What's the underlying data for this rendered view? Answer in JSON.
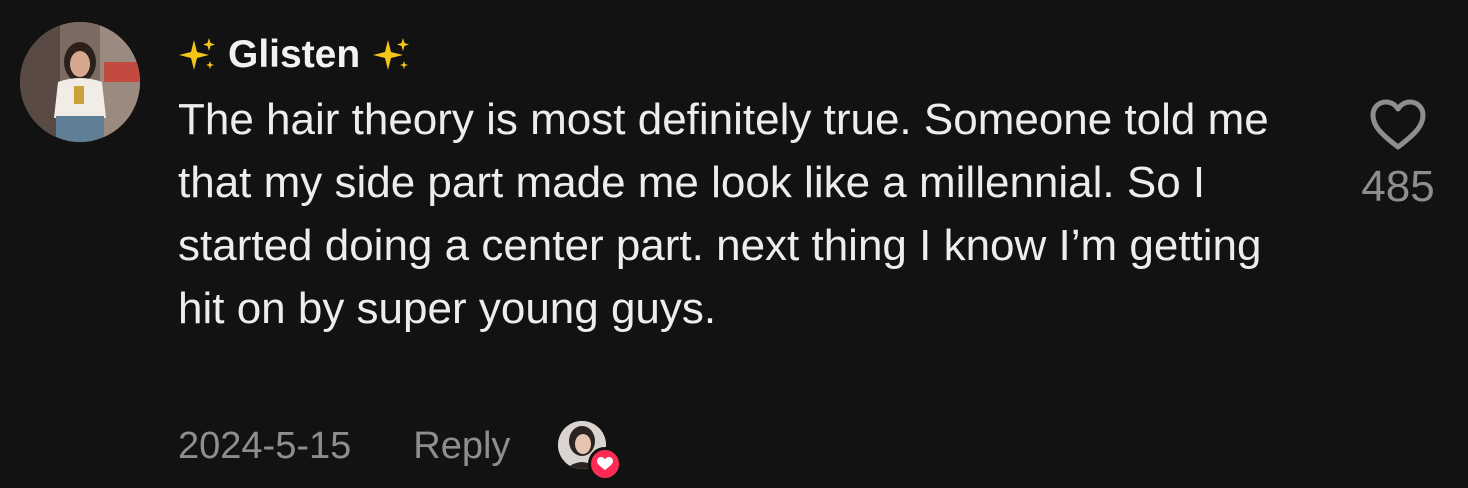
{
  "comment": {
    "username": "Glisten",
    "username_decoration_icon": "sparkles-icon",
    "avatar_icon": "user-avatar",
    "text": "The hair theory is most definitely true. Someone told me that my side part made me look like a millennial. So I started doing a center part. next thing I know I’m getting hit on by super young guys.",
    "date": "2024-5-15",
    "reply_label": "Reply",
    "creator_liked_icon": "creator-avatar-with-heart",
    "like_icon": "heart-outline-icon",
    "like_count": "485"
  },
  "colors": {
    "background": "#121212",
    "text_primary": "#ededed",
    "text_secondary": "#8e8e8e",
    "sparkle": "#f5c518",
    "heart_badge": "#fe2c55"
  }
}
